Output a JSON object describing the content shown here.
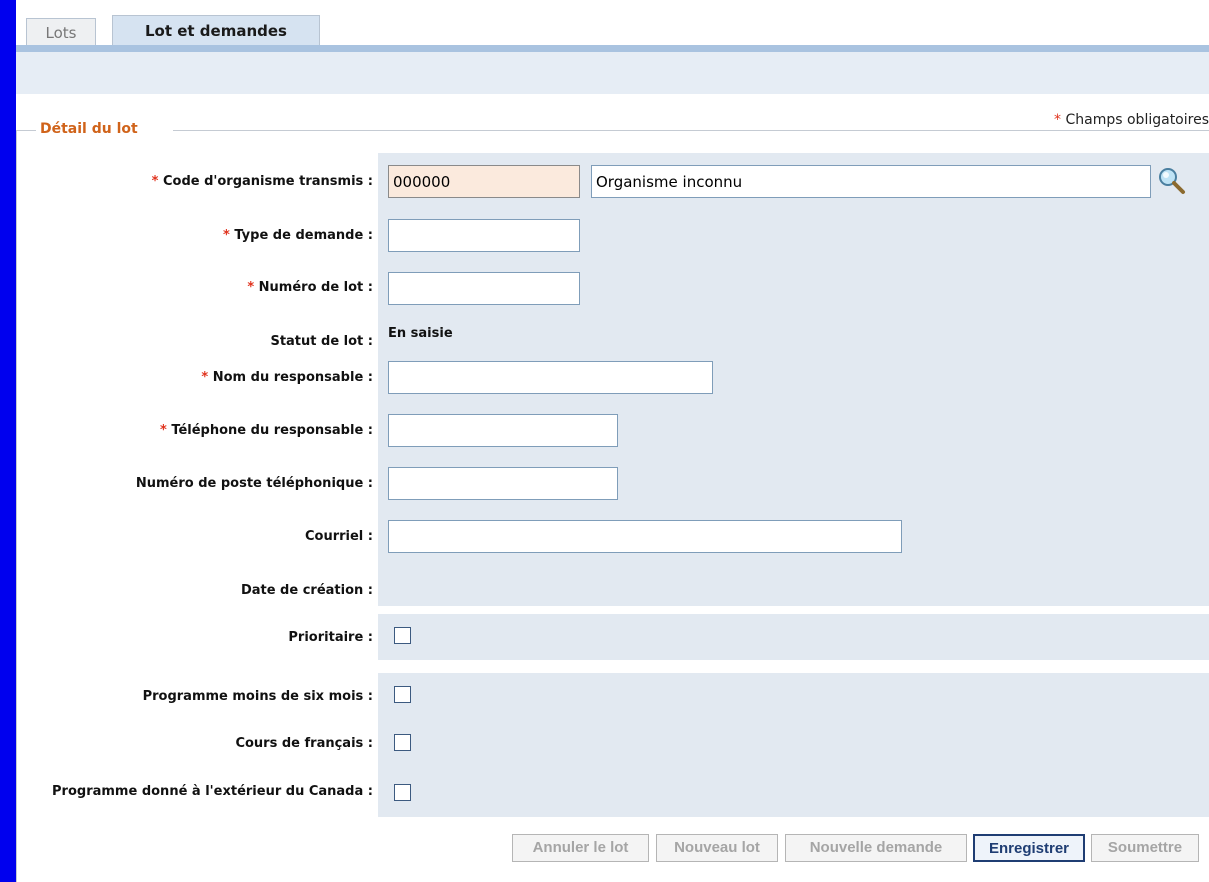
{
  "tabs": [
    {
      "label": "Lots",
      "active": false
    },
    {
      "label": "Lot et demandes",
      "active": true
    }
  ],
  "required_note": {
    "star": "*",
    "text": "Champs obligatoires"
  },
  "section": {
    "legend": "Détail du lot"
  },
  "fields": {
    "code": {
      "label": "Code d'organisme transmis :",
      "value": "000000",
      "org_name": "Organisme inconnu",
      "required": true
    },
    "type_demande": {
      "label": "Type de demande :",
      "value": "",
      "required": true
    },
    "numero_lot": {
      "label": "Numéro de lot :",
      "value": "",
      "required": true
    },
    "statut": {
      "label": "Statut de lot :",
      "value": "En saisie"
    },
    "nom_responsable": {
      "label": "Nom du responsable :",
      "value": "",
      "required": true
    },
    "telephone": {
      "label": "Téléphone du responsable :",
      "value": "",
      "required": true
    },
    "poste": {
      "label": "Numéro de poste téléphonique :",
      "value": ""
    },
    "courriel": {
      "label": "Courriel :",
      "value": ""
    },
    "date_creation": {
      "label": "Date de création :",
      "value": ""
    },
    "prioritaire": {
      "label": "Prioritaire :",
      "checked": false
    },
    "moins_six_mois": {
      "label": "Programme moins de six mois :",
      "checked": false
    },
    "cours_francais": {
      "label": "Cours de français :",
      "checked": false
    },
    "exterieur_canada": {
      "label": "Programme donné à l'extérieur du Canada :",
      "checked": false
    }
  },
  "buttons": {
    "annuler": "Annuler le lot",
    "nouveau_lot": "Nouveau lot",
    "nouvelle_demande": "Nouvelle demande",
    "enregistrer": "Enregistrer",
    "soumettre": "Soumettre"
  },
  "icons": {
    "search": "search-magnifier-icon"
  },
  "colors": {
    "outer_bg": "#0000ee",
    "legend": "#d0631a",
    "required_star": "#e0321d",
    "form_bg": "#e2e9f1",
    "primary_button": "#1f3d73"
  }
}
